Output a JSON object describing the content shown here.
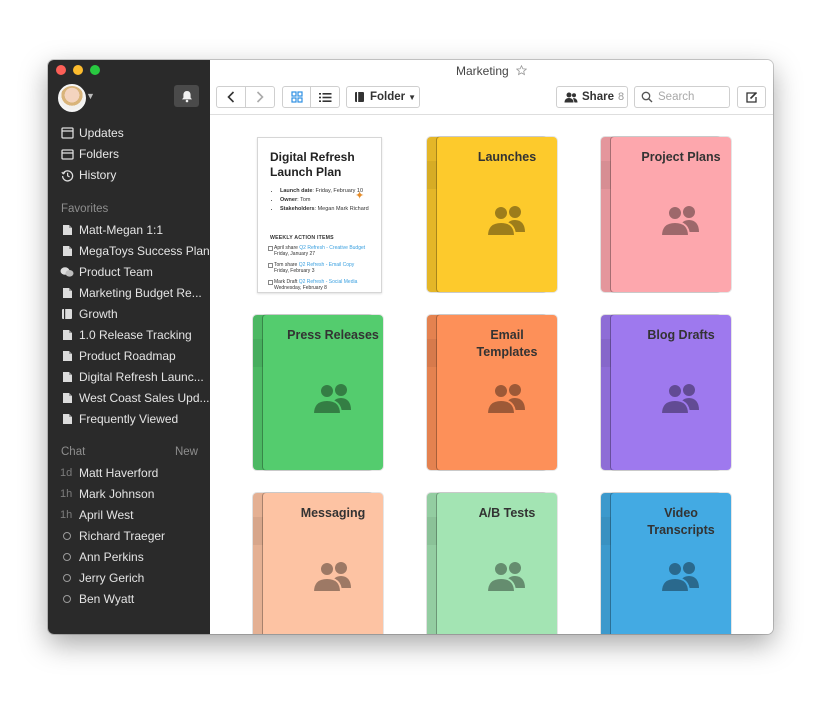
{
  "window": {
    "title": "Marketing"
  },
  "colors": {
    "sidebar": "#2a2a2a",
    "accent": "#3aa0e0",
    "traffic_red": "#fc5f57",
    "traffic_yellow": "#fdbc2e",
    "traffic_green": "#28c940"
  },
  "sidebar": {
    "nav": [
      {
        "label": "Updates",
        "icon": "updates-icon"
      },
      {
        "label": "Folders",
        "icon": "folders-icon"
      },
      {
        "label": "History",
        "icon": "history-icon"
      }
    ],
    "favorites_label": "Favorites",
    "favorites": [
      {
        "label": "Matt-Megan 1:1",
        "icon": "document-icon"
      },
      {
        "label": "MegaToys Success Plan",
        "icon": "document-icon"
      },
      {
        "label": "Product Team",
        "icon": "chat-bubbles-icon"
      },
      {
        "label": "Marketing Budget Re...",
        "icon": "document-icon"
      },
      {
        "label": "Growth",
        "icon": "folder-icon"
      },
      {
        "label": "1.0 Release Tracking",
        "icon": "document-icon"
      },
      {
        "label": "Product Roadmap",
        "icon": "document-icon"
      },
      {
        "label": "Digital Refresh Launc...",
        "icon": "document-icon"
      },
      {
        "label": "West Coast Sales Upd...",
        "icon": "document-icon"
      },
      {
        "label": "Frequently Viewed",
        "icon": "document-icon"
      }
    ],
    "chat_label": "Chat",
    "chat_new": "New",
    "chats": [
      {
        "time": "1d",
        "name": "Matt Haverford"
      },
      {
        "time": "1h",
        "name": "Mark Johnson"
      },
      {
        "time": "1h",
        "name": "April West"
      },
      {
        "time": "",
        "name": "Richard Traeger"
      },
      {
        "time": "",
        "name": "Ann Perkins"
      },
      {
        "time": "",
        "name": "Jerry Gerich"
      },
      {
        "time": "",
        "name": "Ben Wyatt"
      }
    ]
  },
  "toolbar": {
    "folder_label": "Folder",
    "share_label": "Share",
    "share_count": "8",
    "search_placeholder": "Search"
  },
  "document": {
    "title": "Digital Refresh Launch Plan",
    "bullets": [
      {
        "key": "Launch date",
        "value": ": Friday, February 10"
      },
      {
        "key": "Owner",
        "value": ": Tom"
      },
      {
        "key": "Stakeholders",
        "value": ": Megan Mark Richard"
      }
    ],
    "weekly_label": "WEEKLY ACTION ITEMS",
    "tasks": [
      {
        "who": "April share ",
        "link": "Q2 Refresh - Creative Budget",
        "date": " Friday, January 27"
      },
      {
        "who": "Tom share ",
        "link": "Q2 Refresh - Email Copy",
        "date": " Friday, February 3"
      },
      {
        "who": "Mark Draft ",
        "link": "Q2 Refresh - Social Media",
        "date": " Wednesday, February 8"
      }
    ]
  },
  "folders": [
    {
      "label": "Launches",
      "color": "#fdca2c"
    },
    {
      "label": "Project Plans",
      "color": "#fda7ad"
    },
    {
      "label": "Press Releases",
      "color": "#54cc6e"
    },
    {
      "label": "Email Templates",
      "color": "#fd9059"
    },
    {
      "label": "Blog Drafts",
      "color": "#9e79ee"
    },
    {
      "label": "Messaging",
      "color": "#fdc3a3"
    },
    {
      "label": "A/B Tests",
      "color": "#a3e4b3"
    },
    {
      "label": "Video Transcripts",
      "color": "#43aae3"
    }
  ]
}
